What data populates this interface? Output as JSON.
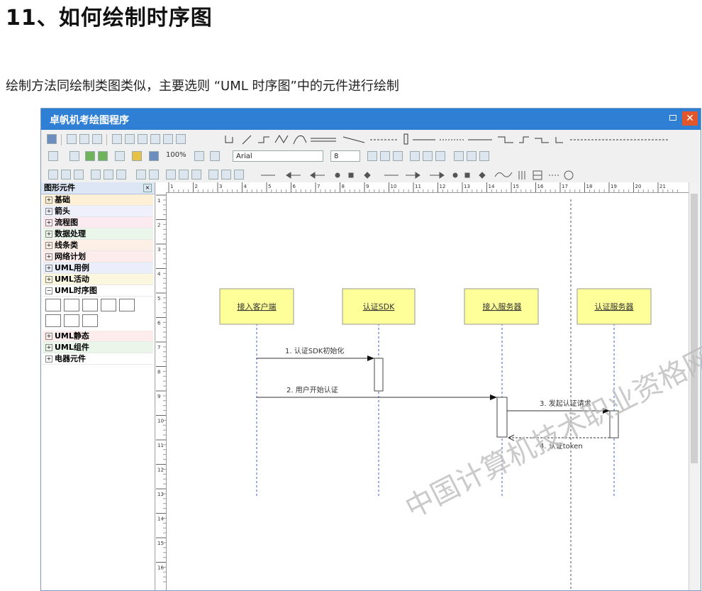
{
  "heading": "11、如何绘制时序图",
  "description": "绘制方法同绘制类图类似，主要选则 “UML 时序图”中的元件进行绘制",
  "app": {
    "title": "卓帆机考绘图程序",
    "zoom": "100%",
    "font_name": "Arial",
    "font_size": "8"
  },
  "panel": {
    "title": "图形元件",
    "categories_top": [
      "基础",
      "箭头",
      "流程图",
      "数据处理",
      "线条类",
      "网络计划",
      "UML用例",
      "UML活动"
    ],
    "expanded": "UML时序图",
    "categories_bottom": [
      "UML静态",
      "UML组件",
      "电器元件"
    ]
  },
  "ruler": [
    "1",
    "2",
    "3",
    "4",
    "5",
    "6",
    "7",
    "8",
    "9",
    "10",
    "11",
    "12",
    "13",
    "14",
    "15",
    "16",
    "17",
    "18",
    "19",
    "20",
    "21"
  ],
  "ruler_left": [
    "1",
    "2",
    "3",
    "4",
    "5",
    "6",
    "7",
    "8",
    "9",
    "10",
    "11",
    "12",
    "13",
    "14",
    "15",
    "16"
  ],
  "diagram": {
    "objects": [
      "接入客户端",
      "认证SDK",
      "接入服务器",
      "认证服务器"
    ],
    "messages": [
      "1. 认证SDK初始化",
      "2. 用户开始认证",
      "3. 发起认证请求",
      "4. 认证token"
    ]
  },
  "watermark": "中国计算机技术职业资格网",
  "colors": {
    "titlebar": "#2f7fd4",
    "object_fill": "#ffff99",
    "lifeline": "#3b5bd6",
    "close_button": "#e2562c"
  }
}
